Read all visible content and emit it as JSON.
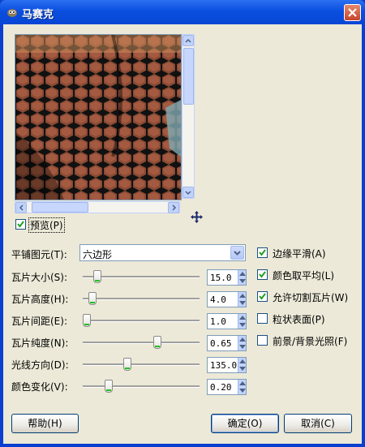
{
  "window": {
    "title": "马赛克",
    "icon": "gimp-icon"
  },
  "preview": {
    "label": "预览(P)",
    "checked": true
  },
  "tile_primitive": {
    "label": "平铺图元(T):",
    "value": "六边形"
  },
  "sliders": [
    {
      "label": "瓦片大小(S):",
      "value": "15.0",
      "fraction": 0.1
    },
    {
      "label": "瓦片高度(H):",
      "value": "4.0",
      "fraction": 0.05
    },
    {
      "label": "瓦片间距(E):",
      "value": "1.0",
      "fraction": 0.0
    },
    {
      "label": "瓦片纯度(N):",
      "value": "0.65",
      "fraction": 0.65
    },
    {
      "label": "光线方向(D):",
      "value": "135.0",
      "fraction": 0.375
    },
    {
      "label": "颜色变化(V):",
      "value": "0.20",
      "fraction": 0.2
    }
  ],
  "options": [
    {
      "label": "边缘平滑(A)",
      "checked": true
    },
    {
      "label": "颜色取平均(L)",
      "checked": true
    },
    {
      "label": "允许切割瓦片(W)",
      "checked": true
    },
    {
      "label": "粒状表面(P)",
      "checked": false
    },
    {
      "label": "前景/背景光照(F)",
      "checked": false
    }
  ],
  "buttons": {
    "help": "帮助(H)",
    "ok": "确定(O)",
    "cancel": "取消(C)"
  }
}
